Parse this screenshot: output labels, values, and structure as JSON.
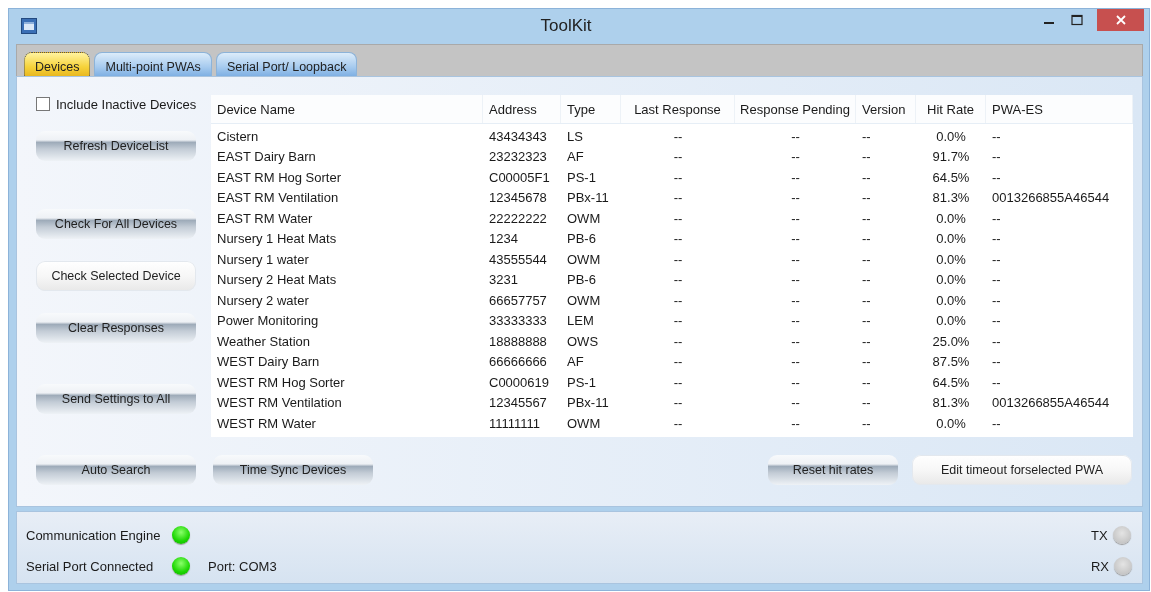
{
  "window": {
    "title": "ToolKit"
  },
  "tabs": [
    {
      "label": "Devices",
      "selected": true
    },
    {
      "label": "Multi-point PWAs",
      "selected": false
    },
    {
      "label": "Serial Port/ Loopback",
      "selected": false
    }
  ],
  "include_inactive": {
    "label": "Include Inactive Devices",
    "checked": false
  },
  "side_buttons": [
    {
      "label": "Refresh DeviceList",
      "highlighted": false
    },
    {
      "label": "Check For All Devices",
      "highlighted": false
    },
    {
      "label": "Check Selected Device",
      "highlighted": true
    },
    {
      "label": "Clear Responses",
      "highlighted": false
    },
    {
      "label": "Send Settings to All",
      "highlighted": false
    }
  ],
  "table": {
    "columns": [
      "Device Name",
      "Address",
      "Type",
      "Last Response",
      "Response Pending",
      "Version",
      "Hit Rate",
      "PWA-ES"
    ],
    "rows": [
      [
        "Cistern",
        "43434343",
        "LS",
        "--",
        "--",
        "--",
        "0.0%",
        "--"
      ],
      [
        "EAST Dairy Barn",
        "23232323",
        "AF",
        "--",
        "--",
        "--",
        "91.7%",
        "--"
      ],
      [
        "EAST RM Hog Sorter",
        "C00005F1",
        "PS-1",
        "--",
        "--",
        "--",
        "64.5%",
        "--"
      ],
      [
        "EAST RM Ventilation",
        "12345678",
        "PBx-11",
        "--",
        "--",
        "--",
        "81.3%",
        "0013266855A46544"
      ],
      [
        "EAST RM Water",
        "22222222",
        "OWM",
        "--",
        "--",
        "--",
        "0.0%",
        "--"
      ],
      [
        "Nursery 1 Heat Mats",
        "1234",
        "PB-6",
        "--",
        "--",
        "--",
        "0.0%",
        "--"
      ],
      [
        "Nursery 1 water",
        "43555544",
        "OWM",
        "--",
        "--",
        "--",
        "0.0%",
        "--"
      ],
      [
        "Nursery 2 Heat Mats",
        "3231",
        "PB-6",
        "--",
        "--",
        "--",
        "0.0%",
        "--"
      ],
      [
        "Nursery 2 water",
        "66657757",
        "OWM",
        "--",
        "--",
        "--",
        "0.0%",
        "--"
      ],
      [
        "Power Monitoring",
        "33333333",
        "LEM",
        "--",
        "--",
        "--",
        "0.0%",
        "--"
      ],
      [
        "Weather Station",
        "18888888",
        "OWS",
        "--",
        "--",
        "--",
        "25.0%",
        "--"
      ],
      [
        "WEST Dairy Barn",
        "66666666",
        "AF",
        "--",
        "--",
        "--",
        "87.5%",
        "--"
      ],
      [
        "WEST RM Hog Sorter",
        "C0000619",
        "PS-1",
        "--",
        "--",
        "--",
        "64.5%",
        "--"
      ],
      [
        "WEST RM Ventilation",
        "12345567",
        "PBx-11",
        "--",
        "--",
        "--",
        "81.3%",
        "0013266855A46544"
      ],
      [
        "WEST RM Water",
        "11111111",
        "OWM",
        "--",
        "--",
        "--",
        "0.0%",
        "--"
      ]
    ]
  },
  "bottom_buttons": [
    {
      "label": "Auto Search",
      "highlighted": false
    },
    {
      "label": "Time Sync Devices",
      "highlighted": false
    },
    {
      "label": "Reset hit rates",
      "highlighted": false
    },
    {
      "label": "Edit timeout forselected PWA",
      "highlighted": true
    }
  ],
  "status": {
    "indicators": [
      {
        "label": "Communication Engine",
        "on": true
      },
      {
        "label": "Serial Port Connected",
        "on": true
      }
    ],
    "port": "Port: COM3",
    "lamps": [
      {
        "label": "TX",
        "on": false
      },
      {
        "label": "RX",
        "on": false
      }
    ]
  }
}
